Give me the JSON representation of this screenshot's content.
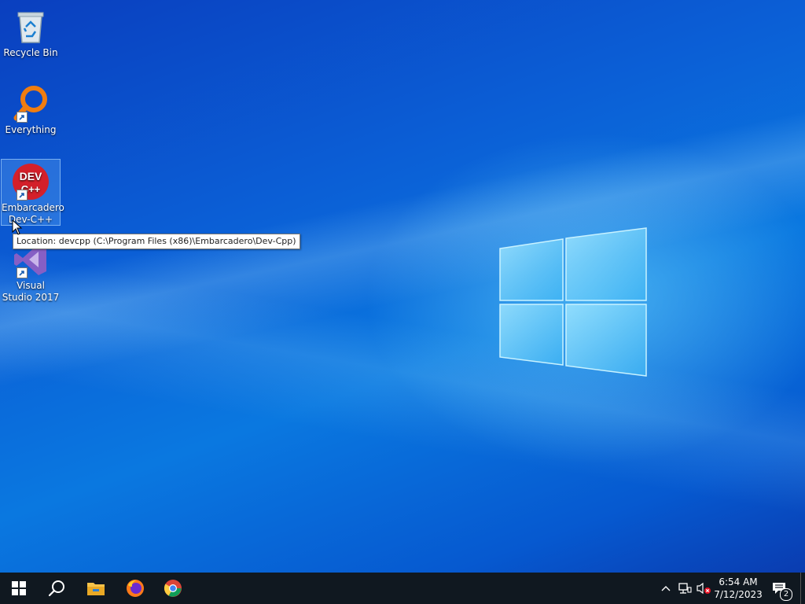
{
  "desktop": {
    "icons": [
      {
        "label": "Recycle Bin",
        "icon": "recycle-bin-icon"
      },
      {
        "label": "Everything",
        "icon": "everything-search-icon"
      },
      {
        "label": "Embarcadero Dev-C++",
        "icon": "devcpp-icon",
        "selected": true,
        "logo_text_top": "DEV",
        "logo_text_bottom": "C++"
      },
      {
        "label": "Visual Studio 2017",
        "icon": "visual-studio-icon"
      }
    ],
    "tooltip": "Location: devcpp (C:\\Program Files (x86)\\Embarcadero\\Dev-Cpp)"
  },
  "taskbar": {
    "apps": [
      {
        "name": "start",
        "icon": "windows-start-icon"
      },
      {
        "name": "search",
        "icon": "search-icon"
      },
      {
        "name": "file-explorer",
        "icon": "folder-icon"
      },
      {
        "name": "firefox",
        "icon": "firefox-icon"
      },
      {
        "name": "chrome",
        "icon": "chrome-icon"
      }
    ],
    "tray": {
      "time": "6:54 AM",
      "date": "7/12/2023",
      "notification_count": "2"
    }
  },
  "colors": {
    "taskbar_bg": "#101820",
    "desktop_accent": "#0a78e0"
  }
}
